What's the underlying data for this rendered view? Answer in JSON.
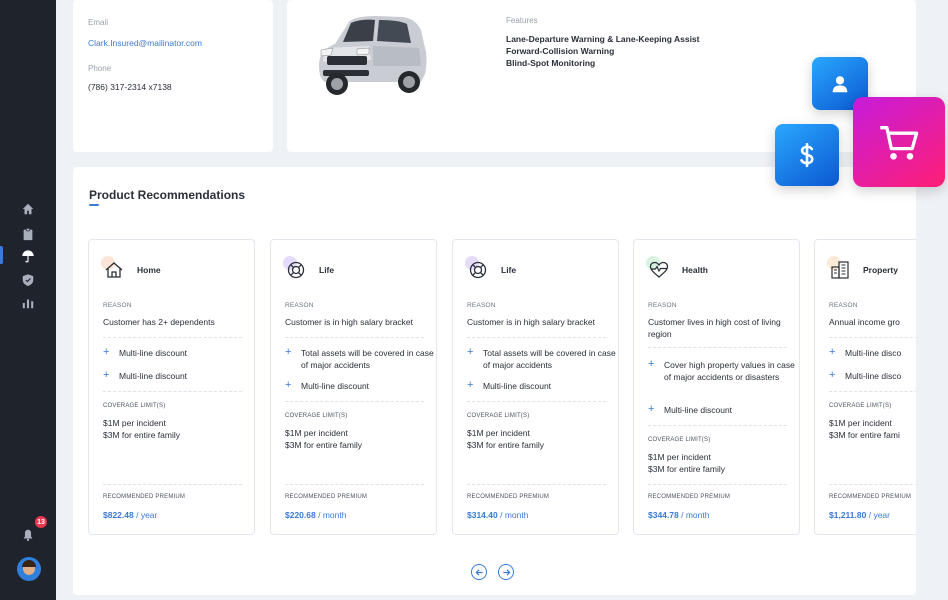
{
  "contact": {
    "email_label": "Email",
    "email": "Clark.Insured@mailinator.com",
    "phone_label": "Phone",
    "phone": "(786) 317-2314 x7138"
  },
  "vehicle": {
    "features_label": "Features",
    "features": [
      "Lane-Departure Warning & Lane-Keeping Assist",
      "Forward-Collision Warning",
      "Blind-Spot Monitoring"
    ]
  },
  "nav": {
    "items": [
      "home-icon",
      "clipboard-icon",
      "umbrella-icon",
      "shield-icon",
      "chart-icon"
    ],
    "notification_count": "13"
  },
  "recommendations": {
    "title": "Product Recommendations",
    "reason_label": "REASON",
    "coverage_label": "COVERAGE LIMIT(S)",
    "premium_label": "RECOMMENDED PREMIUM",
    "cards": [
      {
        "name": "Home",
        "icon": "home-icon",
        "accent": "#f6b48c",
        "reason": "Customer has 2+ dependents",
        "bullets": [
          "Multi-line discount",
          "Multi-line discount"
        ],
        "coverage": [
          "$1M per incident",
          "$3M for entire family"
        ],
        "premium": "$822.48",
        "period": "/ year"
      },
      {
        "name": "Life",
        "icon": "lifebuoy-icon",
        "accent": "#b39cf2",
        "reason": "Customer is in high salary bracket",
        "bullets": [
          "Total assets will be covered in case of major accidents",
          "Multi-line discount"
        ],
        "coverage": [
          "$1M per incident",
          "$3M for entire family"
        ],
        "premium": "$220.68",
        "period": "/ month"
      },
      {
        "name": "Life",
        "icon": "lifebuoy-icon",
        "accent": "#b39cf2",
        "reason": "Customer is in high salary bracket",
        "bullets": [
          "Total assets will be covered in case of major accidents",
          "Multi-line discount"
        ],
        "coverage": [
          "$1M per incident",
          "$3M for entire family"
        ],
        "premium": "$314.40",
        "period": "/ month"
      },
      {
        "name": "Health",
        "icon": "heartbeat-icon",
        "accent": "#8fe0a8",
        "reason": "Customer lives in high cost of living region",
        "bullets": [
          "Cover high property values in case of major accidents or disasters",
          "Multi-line discount"
        ],
        "coverage": [
          "$1M per incident",
          "$3M for entire family"
        ],
        "premium": "$344.78",
        "period": "/ month"
      },
      {
        "name": "Property",
        "icon": "building-icon",
        "accent": "#f4c48a",
        "reason": "Annual income gro",
        "bullets": [
          "Multi-line disco",
          "Multi-line disco"
        ],
        "coverage": [
          "$1M per incident",
          "$3M for entire fami"
        ],
        "premium": "$1,211.80",
        "period": "/ year"
      }
    ]
  },
  "colors": {
    "accent": "#3a7bd5",
    "sidebar": "#1f232c",
    "float_blue": "#0b57d0",
    "float_pink": "#ff1f74"
  }
}
